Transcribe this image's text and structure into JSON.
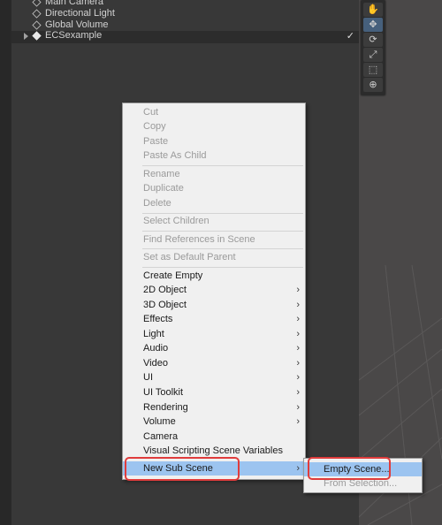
{
  "hierarchy": {
    "items": [
      {
        "label": "Main Camera"
      },
      {
        "label": "Directional Light"
      },
      {
        "label": "Global Volume"
      },
      {
        "label": "ECSexample"
      }
    ],
    "ecs_check": "✓"
  },
  "toolbar": {
    "tools": [
      {
        "icon": "hand-icon",
        "glyph": "✋"
      },
      {
        "icon": "move-icon",
        "glyph": "✥"
      },
      {
        "icon": "rotate-icon",
        "glyph": "⟳"
      },
      {
        "icon": "scale-icon",
        "glyph": "⤢"
      },
      {
        "icon": "rect-icon",
        "glyph": "⬚"
      },
      {
        "icon": "transform-icon",
        "glyph": "⊕"
      }
    ]
  },
  "context_menu": {
    "edit": [
      "Cut",
      "Copy",
      "Paste",
      "Paste As Child"
    ],
    "manage": [
      "Rename",
      "Duplicate",
      "Delete"
    ],
    "select_children": "Select Children",
    "find_references": "Find References in Scene",
    "set_parent": "Set as Default Parent",
    "create": [
      {
        "label": "Create Empty",
        "submenu": false
      },
      {
        "label": "2D Object",
        "submenu": true
      },
      {
        "label": "3D Object",
        "submenu": true
      },
      {
        "label": "Effects",
        "submenu": true
      },
      {
        "label": "Light",
        "submenu": true
      },
      {
        "label": "Audio",
        "submenu": true
      },
      {
        "label": "Video",
        "submenu": true
      },
      {
        "label": "UI",
        "submenu": true
      },
      {
        "label": "UI Toolkit",
        "submenu": true
      },
      {
        "label": "Rendering",
        "submenu": true
      },
      {
        "label": "Volume",
        "submenu": true
      },
      {
        "label": "Camera",
        "submenu": false
      },
      {
        "label": "Visual Scripting Scene Variables",
        "submenu": false
      },
      {
        "label": "New Sub Scene",
        "submenu": true
      }
    ],
    "arrow": "›"
  },
  "submenu": {
    "items": [
      "Empty Scene...",
      "From Selection..."
    ]
  },
  "colors": {
    "highlight": "#9cc4f0",
    "callout": "#e03c3c"
  }
}
